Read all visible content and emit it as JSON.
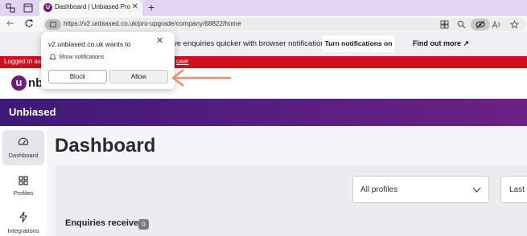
{
  "browser": {
    "tab_title": "Dashboard | Unbiased Pro",
    "tab_favicon_letter": "U",
    "close_glyph": "✕",
    "new_tab_glyph": "+",
    "url": "https://v2.unbiased.co.uk/pro-upgrade/company/68822/home",
    "icons": [
      "workspaces-icon",
      "tab-actions-icon",
      "back-icon",
      "refresh-icon",
      "lock-icon",
      "apps-icon",
      "zoom-icon",
      "tracking-prevention-icon",
      "read-aloud-icon",
      "favorites-icon"
    ]
  },
  "notification_bar": {
    "text": "ve enquiries quicker with browser notifications.",
    "button": "Turn notifications on",
    "link": "Find out more ↗"
  },
  "red_bar": {
    "text": "Logged in as u",
    "link": "user"
  },
  "logo": {
    "letter": "u",
    "text": "nb"
  },
  "brand": {
    "name": "Unbiased",
    "colors": {
      "purple_dark": "#3d1a77",
      "purple_light": "#6c2084",
      "red": "#d10e1b"
    }
  },
  "sidebar": {
    "items": [
      {
        "label": "Dashboard",
        "icon": "gauge-icon",
        "glyph": "◠"
      },
      {
        "label": "Profiles",
        "icon": "grid-icon",
        "glyph": "⊞"
      },
      {
        "label": "Integrations",
        "icon": "lightning-icon",
        "glyph": "ϟ"
      }
    ]
  },
  "main": {
    "title": "Dashboard",
    "profile_select": "All profiles",
    "period_select": "Last w",
    "chevron": "⌄",
    "enquiries_label": "Enquiries received",
    "enquiries_count": "0"
  },
  "popup": {
    "title": "v2.unbiased.co.uk wants to",
    "permission": "Show notifications",
    "close": "✕",
    "block": "Block",
    "allow": "Allow"
  },
  "annotation": {
    "arrow_color": "#f08a6c"
  }
}
